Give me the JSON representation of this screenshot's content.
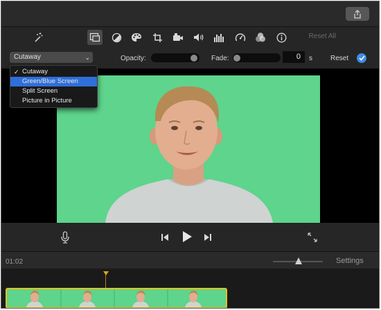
{
  "toolbar": {
    "reset_all_label": "Reset All",
    "icons": [
      "magic-wand-icon",
      "video-overlay-icon",
      "color-balance-icon",
      "color-palette-icon",
      "crop-icon",
      "stabilization-camera-icon",
      "volume-icon",
      "equalizer-icon",
      "speed-icon",
      "filter-icon",
      "info-icon"
    ],
    "active_icon": "video-overlay-icon"
  },
  "overlay_controls": {
    "selected_mode": "Cutaway",
    "opacity_label": "Opacity:",
    "opacity_value": 0.96,
    "fade_label": "Fade:",
    "fade_slider_value": 0.0,
    "fade_value": "0",
    "fade_unit": "s",
    "reset_label": "Reset"
  },
  "dropdown": {
    "items": [
      {
        "label": "Cutaway",
        "checked": true,
        "highlighted": false
      },
      {
        "label": "Green/Blue Screen",
        "checked": false,
        "highlighted": true
      },
      {
        "label": "Split Screen",
        "checked": false,
        "highlighted": false
      },
      {
        "label": "Picture in Picture",
        "checked": false,
        "highlighted": false
      }
    ]
  },
  "timeline": {
    "timecode": "01:02",
    "settings_label": "Settings",
    "zoom_value": 0.5
  },
  "colors": {
    "green_screen": "#5ed48c",
    "accent_blue": "#3d8ee6",
    "clip_border": "#e5c21b"
  }
}
